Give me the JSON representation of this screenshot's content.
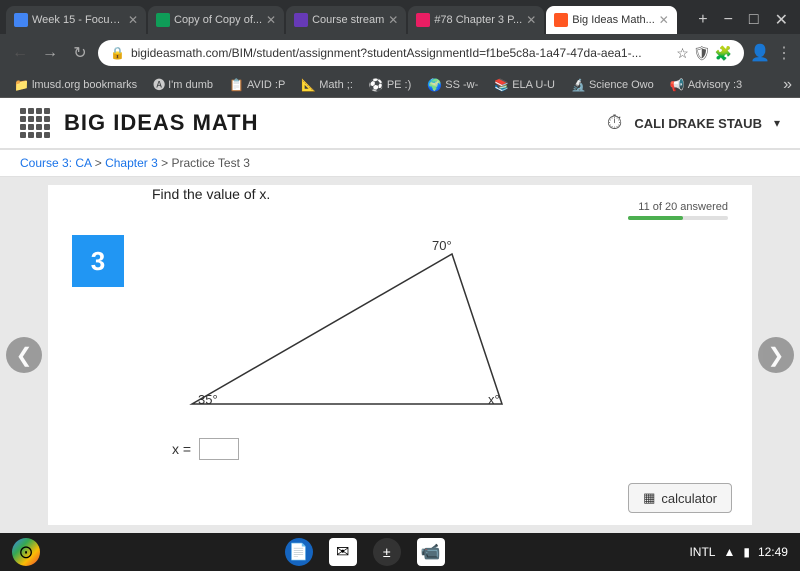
{
  "tabs": [
    {
      "id": "tab1",
      "label": "Week 15 - Focus...",
      "favicon_type": "week15",
      "active": false
    },
    {
      "id": "tab2",
      "label": "Copy of Copy of...",
      "favicon_type": "copyof",
      "active": false
    },
    {
      "id": "tab3",
      "label": "Course stream",
      "favicon_type": "course",
      "active": false
    },
    {
      "id": "tab4",
      "label": "#78 Chapter 3 P...",
      "favicon_type": "chapter",
      "active": false
    },
    {
      "id": "tab5",
      "label": "Big Ideas Math...",
      "favicon_type": "bigideas",
      "active": true
    }
  ],
  "address_bar": {
    "url": "bigideasmath.com/BIM/student/assignment?studentAssignmentId=f1be5c8a-1a47-47da-aea1-..."
  },
  "bookmarks": [
    {
      "label": "lmusd.org bookmarks"
    },
    {
      "label": "I'm dumb"
    },
    {
      "label": "AVID :P"
    },
    {
      "label": "Math ;:"
    },
    {
      "label": "PE :)"
    },
    {
      "label": "SS -w-"
    },
    {
      "label": "ELA U-U"
    },
    {
      "label": "Science Owo"
    },
    {
      "label": "Advisory :3"
    }
  ],
  "header": {
    "logo": "BIG IDEAS MATH",
    "user": "CALI DRAKE STAUB"
  },
  "breadcrumb": {
    "parts": [
      "Course 3: CA",
      "Chapter 3",
      "Practice Test 3"
    ]
  },
  "progress": {
    "label": "11 of 20 answered",
    "percent": 55
  },
  "question": {
    "number": "3",
    "text": "Find the value of x.",
    "triangle": {
      "angle_top": "70°",
      "angle_bottom_left": "35°",
      "angle_bottom_right": "x°"
    },
    "answer_label": "x =",
    "answer_placeholder": ""
  },
  "calculator_label": "calculator",
  "taskbar": {
    "keyboard_layout": "INTL",
    "time": "12:49"
  },
  "icons": {
    "back": "←",
    "forward": "→",
    "reload": "↻",
    "nav_left": "❮",
    "nav_right": "❯",
    "timer": "⏱",
    "dropdown": "▾",
    "calculator": "▦",
    "wifi": "▲",
    "battery": "▮"
  }
}
